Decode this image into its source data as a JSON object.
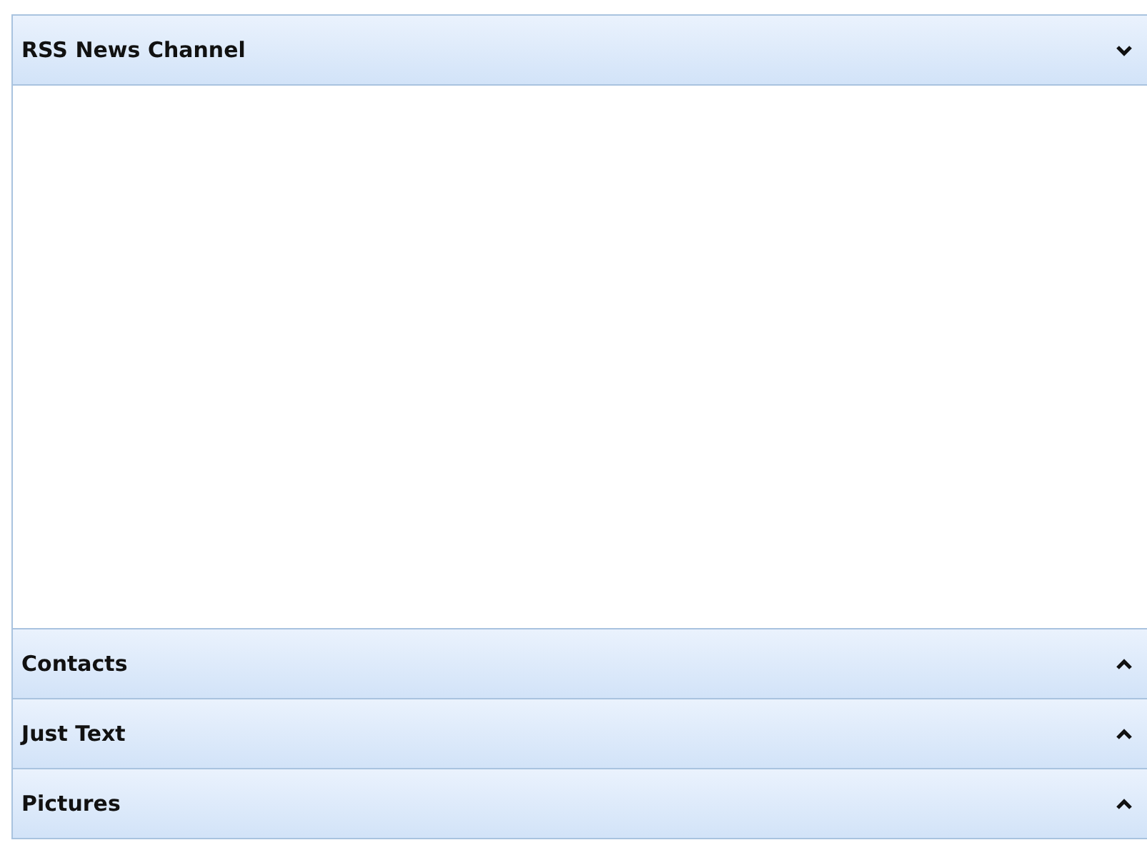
{
  "panels": [
    {
      "title": "RSS News Channel",
      "expanded": true
    },
    {
      "title": "Contacts",
      "expanded": false
    },
    {
      "title": "Just Text",
      "expanded": false
    },
    {
      "title": "Pictures",
      "expanded": false
    }
  ]
}
